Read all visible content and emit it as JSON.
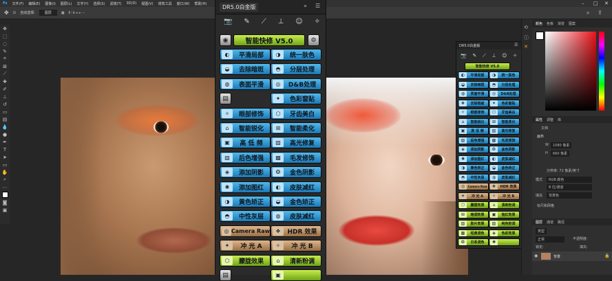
{
  "menu": {
    "ps_logo": "Ps",
    "items": [
      "文件(F)",
      "编辑(E)",
      "图像(I)",
      "图层(L)",
      "文字(Y)",
      "选择(S)",
      "滤镜(T)",
      "3D(D)",
      "视图(V)",
      "增效工具",
      "窗口(W)",
      "帮助(H)"
    ]
  },
  "options": {
    "auto_select_label": "自动选择:",
    "layer_select": "图层"
  },
  "dr5": {
    "title": "DR5.0白金版",
    "header_button": "智能快修 V5.0",
    "rows": [
      {
        "left": "平滑局部",
        "right": "统一肤色",
        "color": "blue"
      },
      {
        "left": "去除暗斑",
        "right": "分层处理",
        "color": "blue"
      },
      {
        "left": "表面平滑",
        "right": "D&B处理",
        "color": "blue"
      },
      {
        "left": "",
        "right": "色彩窗贴",
        "color": "blue"
      },
      {
        "left": "眼部修饰",
        "right": "牙齿美白",
        "color": "blue"
      },
      {
        "left": "智能锐化",
        "right": "智能柔化",
        "color": "blue"
      },
      {
        "left": "高 低 频",
        "right": "高光修复",
        "color": "blue"
      },
      {
        "left": "后色增强",
        "right": "毛发修饰",
        "color": "blue"
      },
      {
        "left": "添加阴影",
        "right": "金色阴影",
        "color": "blue"
      },
      {
        "left": "添加图红",
        "right": "皮肤减红",
        "color": "blue"
      },
      {
        "left": "黄色矫正",
        "right": "金色矫正",
        "color": "blue"
      },
      {
        "left": "中性灰层",
        "right": "皮肤减红",
        "color": "blue"
      },
      {
        "left": "Camera Raw",
        "right": "HDR 效果",
        "color": "tan"
      },
      {
        "left": "冲 光 A",
        "right": "冲 光 B",
        "color": "tan"
      },
      {
        "left": "朦胧效果",
        "right": "清新粉调",
        "color": "green"
      },
      {
        "left": "",
        "right": "",
        "color": "green"
      }
    ]
  },
  "mini": {
    "title": "DR5.0白金版",
    "header_button": "智能快修 V5.0",
    "rows": [
      {
        "left": "平滑局部",
        "right": "统一肤色",
        "color": "blue"
      },
      {
        "left": "去除暗斑",
        "right": "分层处理",
        "color": "blue"
      },
      {
        "left": "表面平滑",
        "right": "D&B处理",
        "color": "blue"
      },
      {
        "left": "去除瑕疵",
        "right": "色彩窗贴",
        "color": "blue"
      },
      {
        "left": "眼部修饰",
        "right": "牙齿美白",
        "color": "blue"
      },
      {
        "left": "智能锐化",
        "right": "智能柔化",
        "color": "blue"
      },
      {
        "left": "高 低 频",
        "right": "高光修复",
        "color": "blue"
      },
      {
        "left": "后色增强",
        "right": "毛发修饰",
        "color": "blue"
      },
      {
        "left": "添加阴影",
        "right": "金色阴影",
        "color": "blue"
      },
      {
        "left": "添加图红",
        "right": "皮肤减红",
        "color": "blue"
      },
      {
        "left": "黄色矫正",
        "right": "金色矫正",
        "color": "blue"
      },
      {
        "left": "中性灰层",
        "right": "皮肤减红",
        "color": "blue"
      },
      {
        "left": "Camera Raw",
        "right": "HDR 效果",
        "color": "tan"
      },
      {
        "left": "冲 光 A",
        "right": "冲 光 B",
        "color": "tan"
      },
      {
        "left": "朦胧效果",
        "right": "清新粉调",
        "color": "green"
      },
      {
        "left": "暗调效果",
        "right": "铭红效果",
        "color": "green"
      },
      {
        "left": "胶片效果",
        "right": "纯色粉调",
        "color": "green"
      },
      {
        "left": "经典调色",
        "right": "色彩效果",
        "color": "green"
      },
      {
        "left": "日系调色",
        "right": "",
        "color": "green"
      }
    ]
  },
  "right": {
    "color_tabs": [
      "颜色",
      "色板",
      "渐变",
      "图案"
    ],
    "prop_tabs": [
      "属性",
      "调整",
      "库"
    ],
    "doc_label": "文档",
    "canvas_label": "画布",
    "w_label": "W",
    "w_value": "1080 像素",
    "h_label": "H",
    "h_value": "660 像素",
    "resolution": "分辨率: 72 像素/英寸",
    "mode_label": "模式",
    "mode_value": "RGB 颜色",
    "depth_value": "8 位/通道",
    "fill_label": "填充",
    "fill_value": "背景色",
    "rulers_label": "标尺和网格",
    "layer_tabs": [
      "图层",
      "通道",
      "路径"
    ],
    "kind_label": "类型",
    "blend_value": "正常",
    "opacity_label": "不透明度:",
    "lock_label": "锁定:",
    "fill2_label": "填充:",
    "layer_name": "背景"
  },
  "colors": {
    "blue": "#2f95d0",
    "green": "#9ccd30",
    "tan": "#c59566",
    "panel": "#2b2b2b"
  }
}
